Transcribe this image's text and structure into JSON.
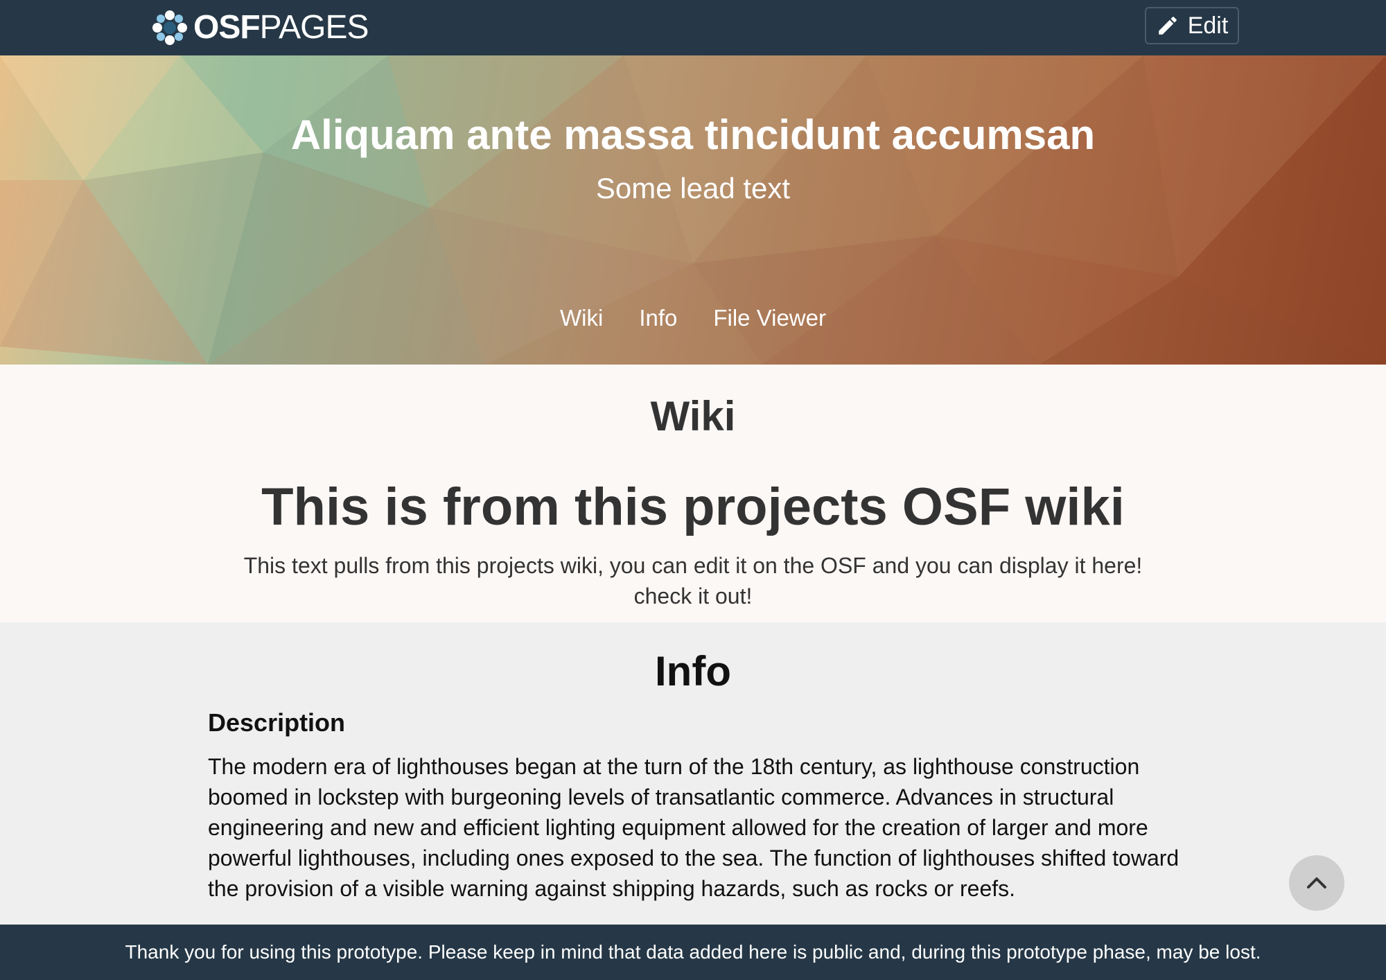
{
  "navbar": {
    "brand_bold": "OSF",
    "brand_light": "PAGES",
    "edit_label": "Edit"
  },
  "hero": {
    "title": "Aliquam ante massa tincidunt accumsan",
    "lead": "Some lead text",
    "nav": [
      {
        "label": "Wiki"
      },
      {
        "label": "Info"
      },
      {
        "label": "File Viewer"
      }
    ]
  },
  "wiki": {
    "section_title": "Wiki",
    "heading": "This is from this projects OSF wiki",
    "body": "This text pulls from this projects wiki, you can edit it on the OSF and you can display it here! check it out!"
  },
  "info": {
    "section_title": "Info",
    "subheading": "Description",
    "body": "The modern era of lighthouses began at the turn of the 18th century, as lighthouse construction boomed in lockstep with burgeoning levels of transatlantic commerce. Advances in structural engineering and new and efficient lighting equipment allowed for the creation of larger and more powerful lighthouses, including ones exposed to the sea. The function of lighthouses shifted toward the provision of a visible warning against shipping hazards, such as rocks or reefs."
  },
  "footer": {
    "notice": "Thank you for using this prototype. Please keep in mind that data added here is public and, during this prototype phase, may be lost."
  },
  "icons": {
    "logo": "osf-logo-icon",
    "edit": "pencil-icon",
    "scroll_top": "chevron-up-icon"
  },
  "colors": {
    "navbar_bg": "#263847",
    "wiki_bg": "#fcf8f6",
    "info_bg": "#efefef"
  }
}
